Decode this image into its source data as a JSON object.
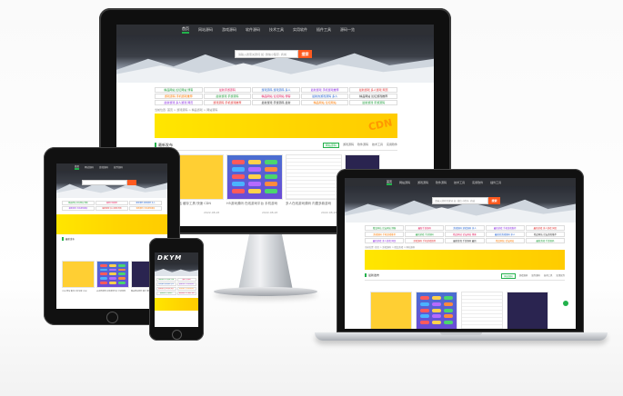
{
  "nav": {
    "items": [
      "首页",
      "网站源码",
      "游戏源码",
      "软件源码",
      "技术工具",
      "实用软件",
      "插件工具",
      "源码一览"
    ],
    "active_index": 0
  },
  "search": {
    "placeholder": "请输入搜索关键词 如: 微信小程序, 商城",
    "button": "搜索"
  },
  "links": [
    "精品网站 论坛网站 博客",
    "最新手游源码",
    "游戏源码 游戏源码 多人",
    "最新游戏 手机游戏推荐",
    "最新游戏 多人游戏 网页",
    "游戏源码 手机游戏推荐",
    "最新游戏 手游源码",
    "精品网站 论坛网站 博客",
    "最新的游戏源码 多人",
    "精品网站 论坛游戏推荐",
    "最新游戏 多人游戏 网页",
    "游戏源码 手机游戏推荐",
    "最新游戏 手游源码 最新",
    "精品网站 论坛网站",
    "最新游戏 手游源码"
  ],
  "breadcrumb": "当前位置: 首页 > 游戏源码 > 精品游戏 > 网站源码",
  "banner_brand": "CDN",
  "section": {
    "title": "最新发布",
    "tabs": [
      "网站源码",
      "游戏源码",
      "软件源码",
      "技术工具",
      "实用软件"
    ]
  },
  "cards": [
    {
      "title": "CDN 网站 缓存工具 快速 CDN",
      "date": "2022-08-26"
    },
    {
      "title": "H5游戏源码 在线游戏平台 手机游戏",
      "date": "2022-08-26"
    },
    {
      "title": "多人在线游戏源码 内置多款游戏",
      "date": "2022-08-26"
    },
    {
      "title": "精品网站源码 程序 博客",
      "date": "2022-08-26"
    }
  ],
  "phone_logo": "DKYM",
  "colors": {
    "nav_bg": "#2d2f34",
    "accent": "#22b14c",
    "search_button": "#ff5a1f",
    "banner": "#ffe600"
  }
}
